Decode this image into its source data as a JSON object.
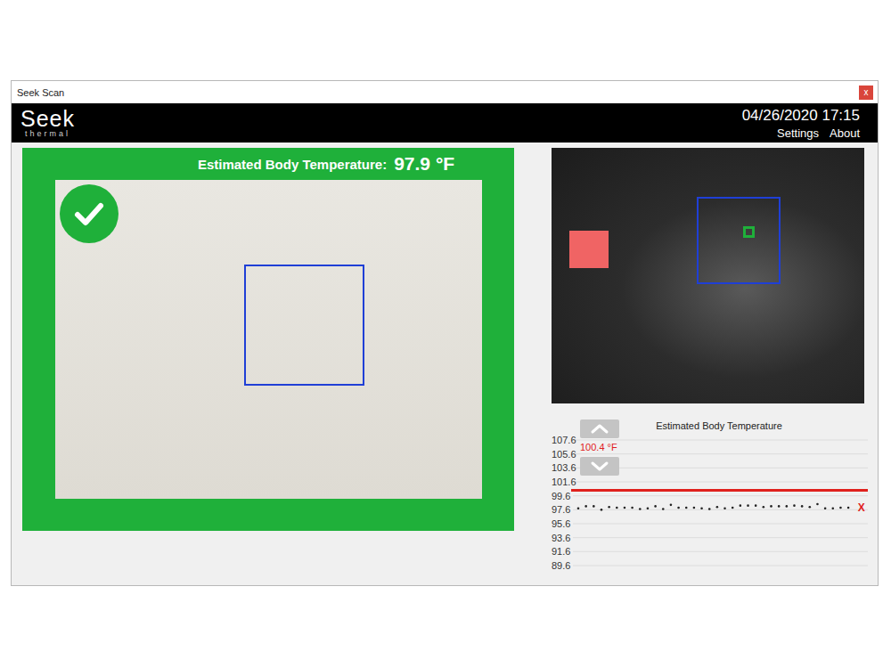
{
  "window": {
    "title": "Seek Scan",
    "close": "x"
  },
  "header": {
    "logo": "Seek",
    "logo_sub": "thermal",
    "datetime": "04/26/2020 17:15",
    "links": [
      "Settings",
      "About"
    ]
  },
  "camera": {
    "label": "Estimated Body Temperature:",
    "reading": "97.9 °F",
    "passed": true
  },
  "chart": {
    "title": "Estimated Body Temperature",
    "ticks": [
      "107.6",
      "105.6",
      "103.6",
      "101.6",
      "99.6",
      "97.6",
      "95.6",
      "93.6",
      "91.6",
      "89.6"
    ],
    "axis_max": 107.6,
    "axis_min": 89.6,
    "threshold": {
      "value": 100.4,
      "label": "100.4 °F"
    },
    "series": [
      97.8,
      98.1,
      98.1,
      97.6,
      98.0,
      97.9,
      97.9,
      97.9,
      97.7,
      97.8,
      98.1,
      97.7,
      98.3,
      97.9,
      97.9,
      97.9,
      97.8,
      97.7,
      98.0,
      97.8,
      97.9,
      98.2,
      98.2,
      98.2,
      98.0,
      98.1,
      98.1,
      98.1,
      98.2,
      98.1,
      98.0,
      98.4,
      97.8,
      97.8,
      97.9,
      97.9
    ],
    "current": {
      "value": 97.9,
      "marker": "X"
    }
  }
}
